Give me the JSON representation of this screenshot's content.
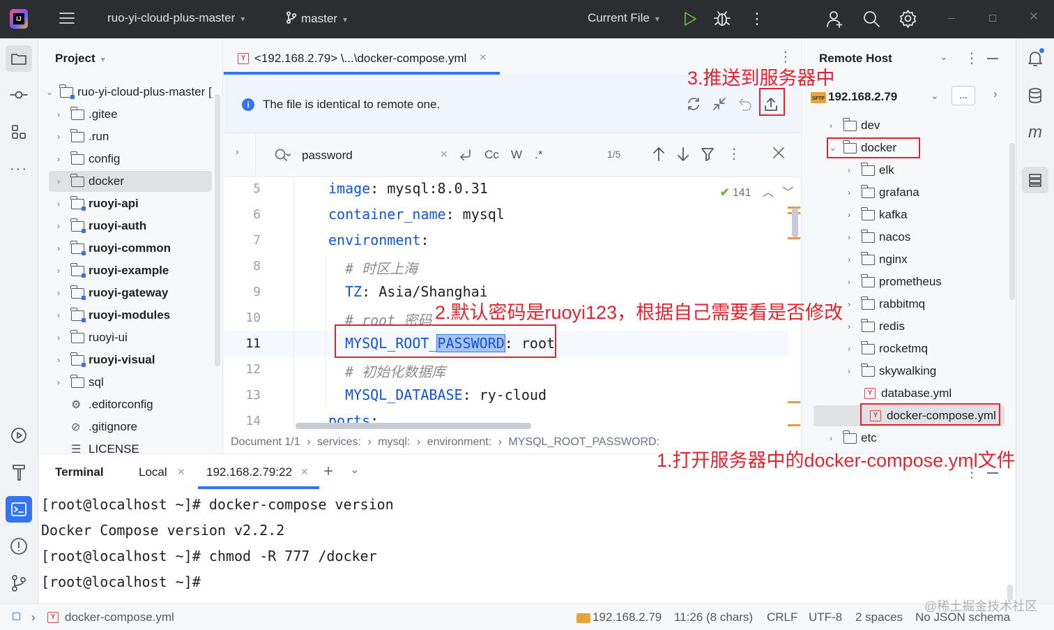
{
  "titlebar": {
    "project_name": "ruo-yi-cloud-plus-master",
    "branch": "master",
    "run_config": "Current File"
  },
  "project_panel": {
    "title": "Project",
    "root": "ruo-yi-cloud-plus-master [",
    "items": [
      {
        "label": ".gitee",
        "kind": "folder",
        "bold": false
      },
      {
        "label": ".run",
        "kind": "folder",
        "bold": false
      },
      {
        "label": "config",
        "kind": "folder",
        "bold": false
      },
      {
        "label": "docker",
        "kind": "folder",
        "bold": false,
        "selected": true
      },
      {
        "label": "ruoyi-api",
        "kind": "module",
        "bold": true
      },
      {
        "label": "ruoyi-auth",
        "kind": "module",
        "bold": true
      },
      {
        "label": "ruoyi-common",
        "kind": "module",
        "bold": true
      },
      {
        "label": "ruoyi-example",
        "kind": "module",
        "bold": true
      },
      {
        "label": "ruoyi-gateway",
        "kind": "module",
        "bold": true
      },
      {
        "label": "ruoyi-modules",
        "kind": "module",
        "bold": true
      },
      {
        "label": "ruoyi-ui",
        "kind": "folder",
        "bold": false
      },
      {
        "label": "ruoyi-visual",
        "kind": "module",
        "bold": true
      },
      {
        "label": "sql",
        "kind": "folder",
        "bold": false
      },
      {
        "label": ".editorconfig",
        "kind": "gear-file",
        "bold": false
      },
      {
        "label": ".gitignore",
        "kind": "ignore-file",
        "bold": false
      },
      {
        "label": "LICENSE",
        "kind": "text-file",
        "bold": false
      }
    ]
  },
  "editor": {
    "tab_label": "<192.168.2.79> \\...\\docker-compose.yml",
    "banner_text": "The file is identical to remote one.",
    "search_query": "password",
    "match_count": "1/5",
    "find_options": [
      "Cc",
      "W",
      ".*"
    ],
    "problems_count": "141",
    "lines": [
      {
        "num": "5",
        "indent": 0,
        "key": "image",
        "sep": ": ",
        "value": "mysql:8.0.31",
        "comment": ""
      },
      {
        "num": "6",
        "indent": 0,
        "key": "container_name",
        "sep": ": ",
        "value": "mysql",
        "comment": ""
      },
      {
        "num": "7",
        "indent": 0,
        "key": "environment",
        "sep": ":",
        "value": "",
        "comment": ""
      },
      {
        "num": "8",
        "indent": 1,
        "key": "",
        "sep": "",
        "value": "",
        "comment": "# 时区上海"
      },
      {
        "num": "9",
        "indent": 1,
        "key": "TZ",
        "sep": ": ",
        "value": "Asia/Shanghai",
        "comment": ""
      },
      {
        "num": "10",
        "indent": 1,
        "key": "",
        "sep": "",
        "value": "",
        "comment": "# root 密码"
      },
      {
        "num": "11",
        "indent": 1,
        "key": "MYSQL_ROOT_",
        "key_match": "PASSWORD",
        "sep": ": ",
        "value": "root",
        "comment": ""
      },
      {
        "num": "12",
        "indent": 1,
        "key": "",
        "sep": "",
        "value": "",
        "comment": "# 初始化数据库"
      },
      {
        "num": "13",
        "indent": 1,
        "key": "MYSQL_DATABASE",
        "sep": ": ",
        "value": "ry-cloud",
        "comment": ""
      },
      {
        "num": "14",
        "indent": 0,
        "key": "ports",
        "sep": ":",
        "value": "",
        "comment": ""
      }
    ],
    "breadcrumb": [
      "Document 1/1",
      "services:",
      "mysql:",
      "environment:",
      "MYSQL_ROOT_PASSWORD:"
    ]
  },
  "remote_host": {
    "title": "Remote Host",
    "host": "192.168.2.79",
    "browse_label": "...",
    "sftp_label": "SFTP",
    "tree": [
      {
        "label": "dev",
        "level": 0,
        "kind": "folder",
        "expanded": false
      },
      {
        "label": "docker",
        "level": 0,
        "kind": "folder",
        "expanded": true
      },
      {
        "label": "elk",
        "level": 1,
        "kind": "folder"
      },
      {
        "label": "grafana",
        "level": 1,
        "kind": "folder"
      },
      {
        "label": "kafka",
        "level": 1,
        "kind": "folder"
      },
      {
        "label": "nacos",
        "level": 1,
        "kind": "folder"
      },
      {
        "label": "nginx",
        "level": 1,
        "kind": "folder"
      },
      {
        "label": "prometheus",
        "level": 1,
        "kind": "folder"
      },
      {
        "label": "rabbitmq",
        "level": 1,
        "kind": "folder"
      },
      {
        "label": "redis",
        "level": 1,
        "kind": "folder"
      },
      {
        "label": "rocketmq",
        "level": 1,
        "kind": "folder"
      },
      {
        "label": "skywalking",
        "level": 1,
        "kind": "folder"
      },
      {
        "label": "database.yml",
        "level": 1,
        "kind": "yml"
      },
      {
        "label": "docker-compose.yml",
        "level": 1,
        "kind": "yml",
        "selected": true
      },
      {
        "label": "etc",
        "level": 0,
        "kind": "folder",
        "expanded": false
      }
    ]
  },
  "terminal": {
    "title": "Terminal",
    "tabs": [
      "Local",
      "192.168.2.79:22"
    ],
    "lines": [
      "[root@localhost ~]# docker-compose version",
      "Docker Compose version v2.2.2",
      "[root@localhost ~]# chmod -R 777 /docker",
      "[root@localhost ~]#"
    ]
  },
  "statusbar": {
    "file": "docker-compose.yml",
    "host": "192.168.2.79",
    "position": "11:26 (8 chars)",
    "line_sep": "CRLF",
    "encoding": "UTF-8",
    "indent": "2 spaces",
    "schema": "No JSON schema"
  },
  "annotations": {
    "step1": "1.打开服务器中的docker-compose.yml文件",
    "step2": "2.默认密码是ruoyi123，根据自己需要看是否修改",
    "step3": "3.推送到服务器中",
    "watermark": "@稀土掘金技术社区"
  },
  "colors": {
    "annotation_red": "#e0242f",
    "accent_blue": "#3574f0",
    "yaml_key_blue": "#0f54d6",
    "titlebar_dark": "#2b2d30",
    "run_green": "#5fb832"
  }
}
